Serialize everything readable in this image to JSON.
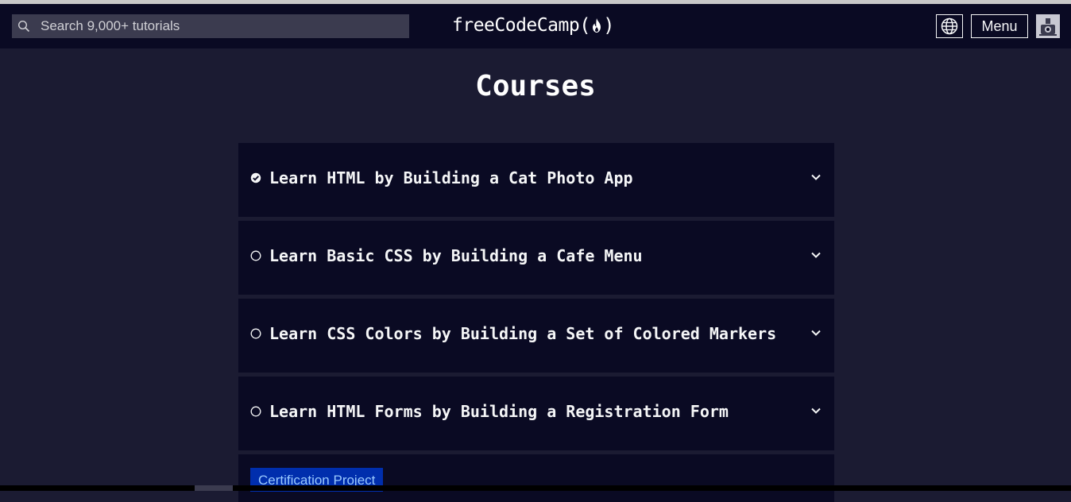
{
  "navbar": {
    "search": {
      "placeholder": "Search 9,000+ tutorials",
      "value": "",
      "icon": "search-icon"
    },
    "logo": {
      "text": "freeCodeCamp",
      "open_paren": "(",
      "close_paren": ")",
      "icon": "flame-icon"
    },
    "language_button": {
      "icon": "globe-icon"
    },
    "menu_button": {
      "label": "Menu"
    },
    "avatar": {
      "icon": "avatar-icon"
    }
  },
  "main": {
    "title": "Courses",
    "courses": [
      {
        "title": "Learn HTML by Building a Cat Photo App",
        "status": "completed",
        "icon": "check-circle-icon"
      },
      {
        "title": "Learn Basic CSS by Building a Cafe Menu",
        "status": "not-started",
        "icon": "empty-circle-icon"
      },
      {
        "title": "Learn CSS Colors by Building a Set of Colored Markers",
        "status": "not-started",
        "icon": "empty-circle-icon"
      },
      {
        "title": "Learn HTML Forms by Building a Registration Form",
        "status": "not-started",
        "icon": "empty-circle-icon"
      }
    ],
    "certification_badge": "Certification Project"
  },
  "colors": {
    "nav_background": "#0a0a23",
    "page_background": "#1b1b32",
    "card_background": "#0a0a23",
    "badge_background": "#002ead",
    "badge_text": "#99c9ff"
  }
}
